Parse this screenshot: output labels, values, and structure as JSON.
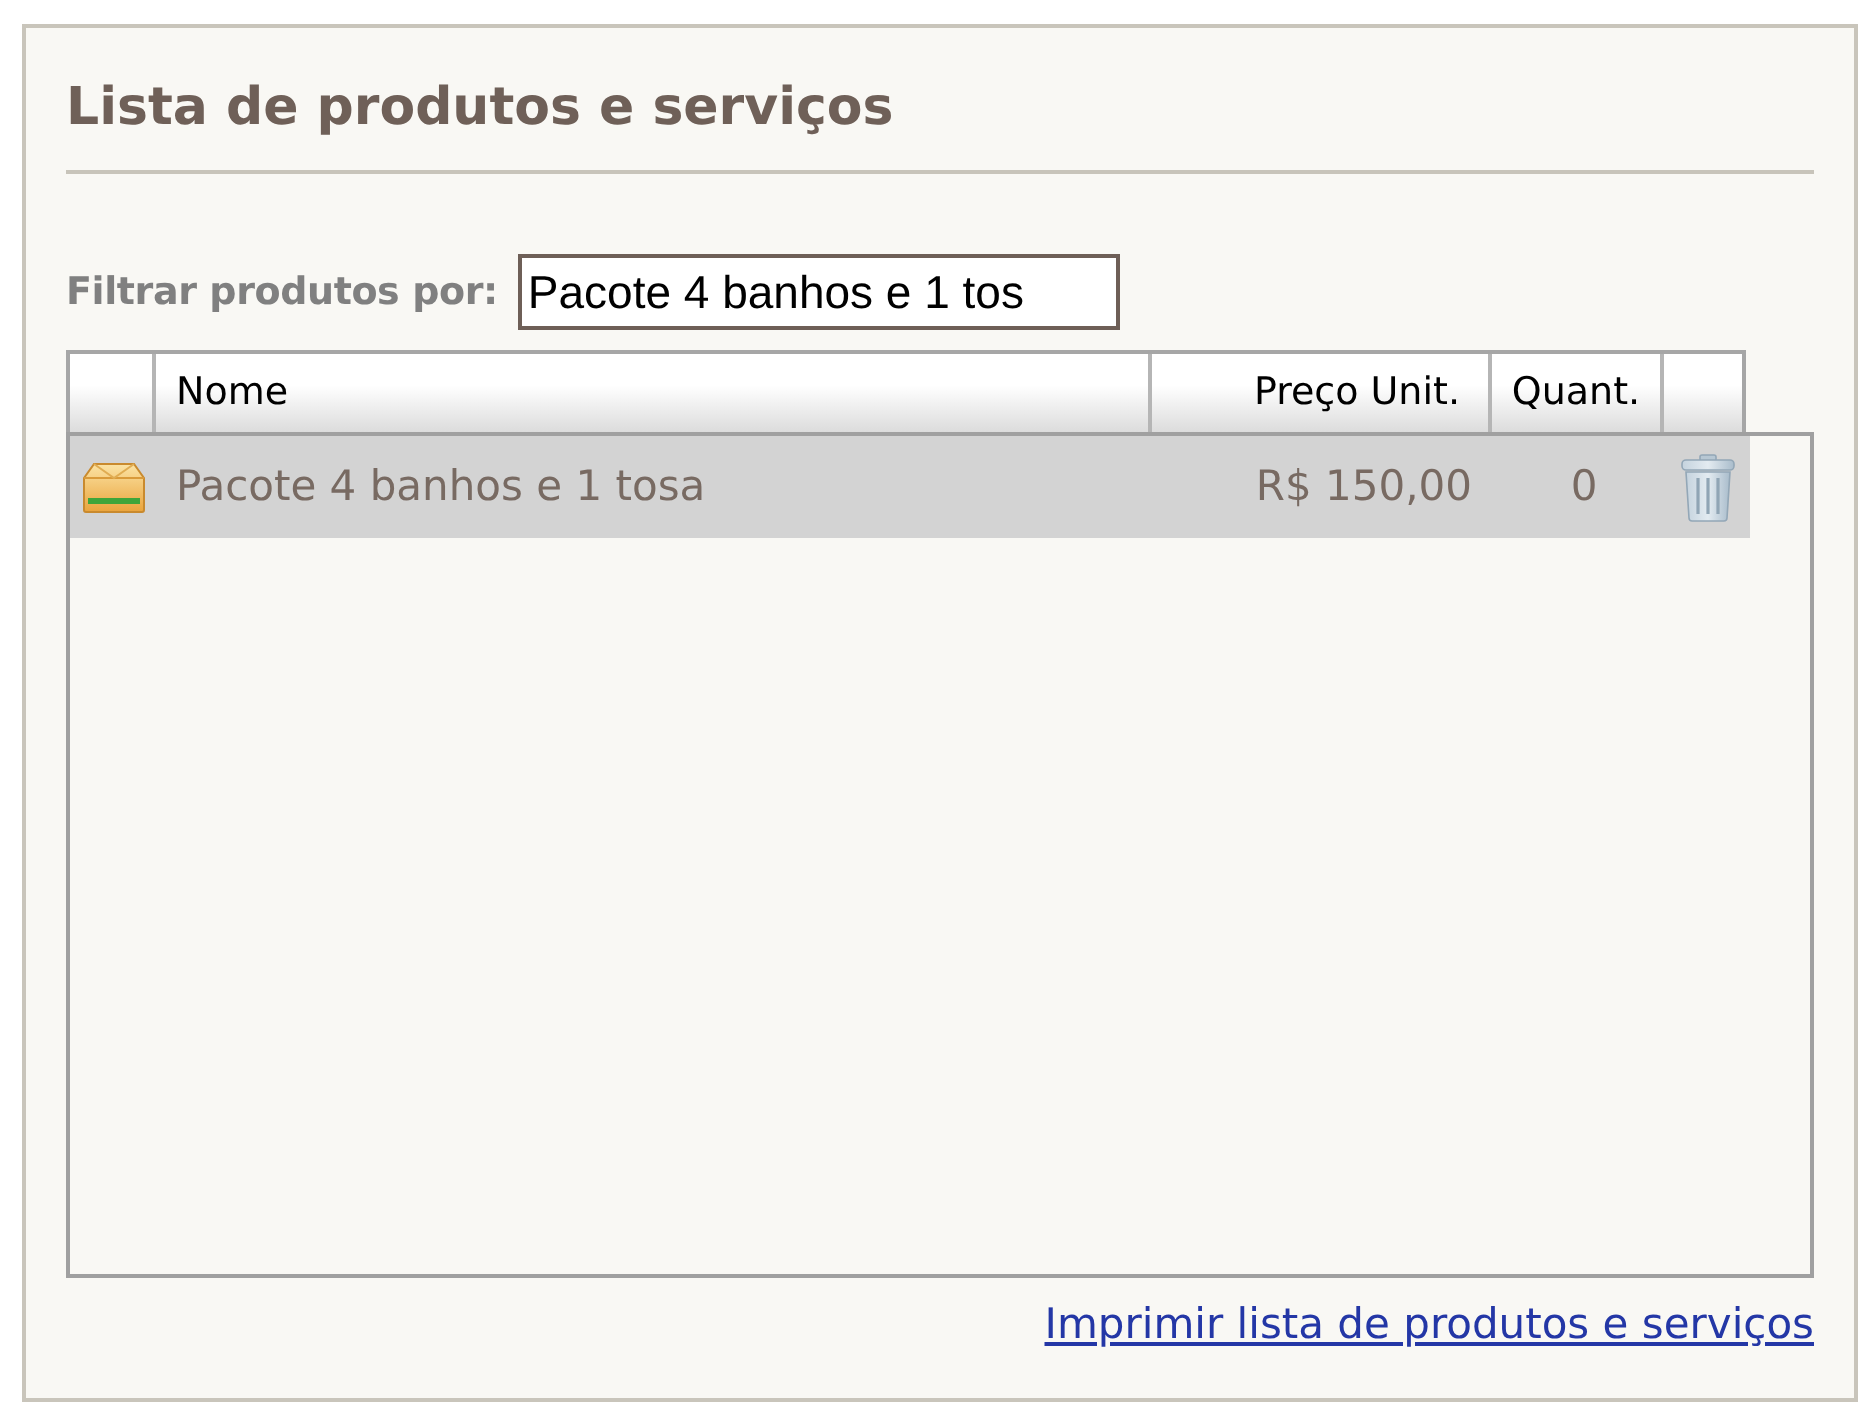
{
  "panel": {
    "title": "Lista de produtos e serviços"
  },
  "filter": {
    "label": "Filtrar produtos por:",
    "value": "Pacote 4 banhos e 1 tos"
  },
  "table": {
    "columns": [
      "Nome",
      "Preço Unit.",
      "Quant."
    ],
    "rows": [
      {
        "name": "Pacote 4 banhos e 1 tosa",
        "price": "R$ 150,00",
        "quantity": "0",
        "selected": true
      }
    ]
  },
  "print_link": {
    "label": "Imprimir lista de produtos e serviços"
  }
}
